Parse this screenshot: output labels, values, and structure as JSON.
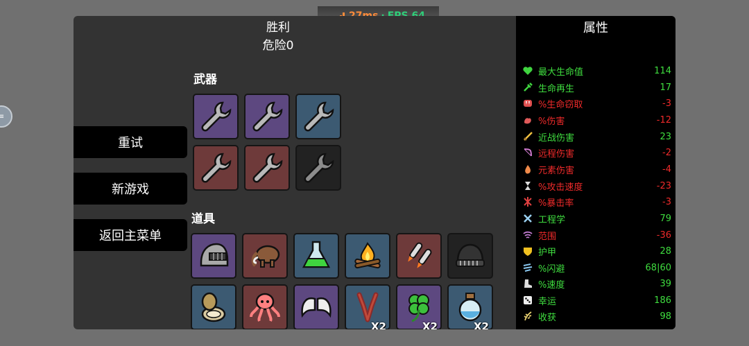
{
  "header": {
    "title": "胜利",
    "danger": "危险0"
  },
  "network": {
    "ms": "27ms",
    "separator": "·",
    "fps": "FPS 64"
  },
  "menu": {
    "retry": "重试",
    "new_game": "新游戏",
    "main_menu": "返回主菜单"
  },
  "sections": {
    "weapons": "武器",
    "items": "道具"
  },
  "weapons": [
    {
      "icon": "wrench-icon",
      "color": "#5d4880"
    },
    {
      "icon": "wrench-icon",
      "color": "#5d4880"
    },
    {
      "icon": "wrench-icon",
      "color": "#3c5a72"
    },
    {
      "icon": "wrench-icon",
      "color": "#6e3a3a"
    },
    {
      "icon": "wrench-icon",
      "color": "#6e3a3a"
    },
    {
      "icon": "wrench-icon",
      "color": "#222222"
    }
  ],
  "items": [
    {
      "icon": "helmet-icon"
    },
    {
      "icon": "mammoth-icon"
    },
    {
      "icon": "potion-flask-icon"
    },
    {
      "icon": "campfire-icon"
    },
    {
      "icon": "rockets-icon"
    },
    {
      "icon": "beanie-icon"
    },
    {
      "icon": "compass-icon"
    },
    {
      "icon": "octopus-icon"
    },
    {
      "icon": "wings-icon"
    },
    {
      "icon": "claw-arm-icon",
      "qty": "X2"
    },
    {
      "icon": "clover-icon",
      "qty": "X2"
    },
    {
      "icon": "potion-bottle-icon",
      "qty": "X2"
    }
  ],
  "stats": {
    "title": "属性",
    "rows": [
      {
        "name": "最大生命值",
        "value": "114",
        "sign": "pos",
        "icon": "heart-icon"
      },
      {
        "name": "生命再生",
        "value": "17",
        "sign": "pos",
        "icon": "syringe-icon"
      },
      {
        "name": "%生命窃取",
        "value": "-3",
        "sign": "neg",
        "icon": "fangs-icon"
      },
      {
        "name": "%伤害",
        "value": "-12",
        "sign": "neg",
        "icon": "muscle-icon"
      },
      {
        "name": "近战伤害",
        "value": "23",
        "sign": "pos",
        "icon": "sword-icon"
      },
      {
        "name": "远程伤害",
        "value": "-2",
        "sign": "neg",
        "icon": "bow-icon"
      },
      {
        "name": "元素伤害",
        "value": "-4",
        "sign": "neg",
        "icon": "flame-icon"
      },
      {
        "name": "%攻击速度",
        "value": "-23",
        "sign": "neg",
        "icon": "hourglass-icon"
      },
      {
        "name": "%暴击率",
        "value": "-3",
        "sign": "neg",
        "icon": "crit-icon"
      },
      {
        "name": "工程学",
        "value": "79",
        "sign": "pos",
        "icon": "tools-icon"
      },
      {
        "name": "范围",
        "value": "-36",
        "sign": "neg",
        "icon": "range-icon"
      },
      {
        "name": "护甲",
        "value": "28",
        "sign": "pos",
        "icon": "shield-icon"
      },
      {
        "name": "%闪避",
        "value": "68|60",
        "sign": "pos",
        "icon": "dodge-icon"
      },
      {
        "name": "%速度",
        "value": "39",
        "sign": "pos",
        "icon": "boot-icon"
      },
      {
        "name": "幸运",
        "value": "186",
        "sign": "pos",
        "icon": "dice-icon"
      },
      {
        "name": "收获",
        "value": "98",
        "sign": "pos",
        "icon": "harvest-icon"
      }
    ]
  },
  "colors": {
    "positive": "#3fdd3f",
    "negative": "#ee2a2a",
    "tier_purple": "#5d4880",
    "tier_blue": "#3c5a72",
    "tier_red": "#6e3a3a",
    "tier_black": "#222222"
  }
}
